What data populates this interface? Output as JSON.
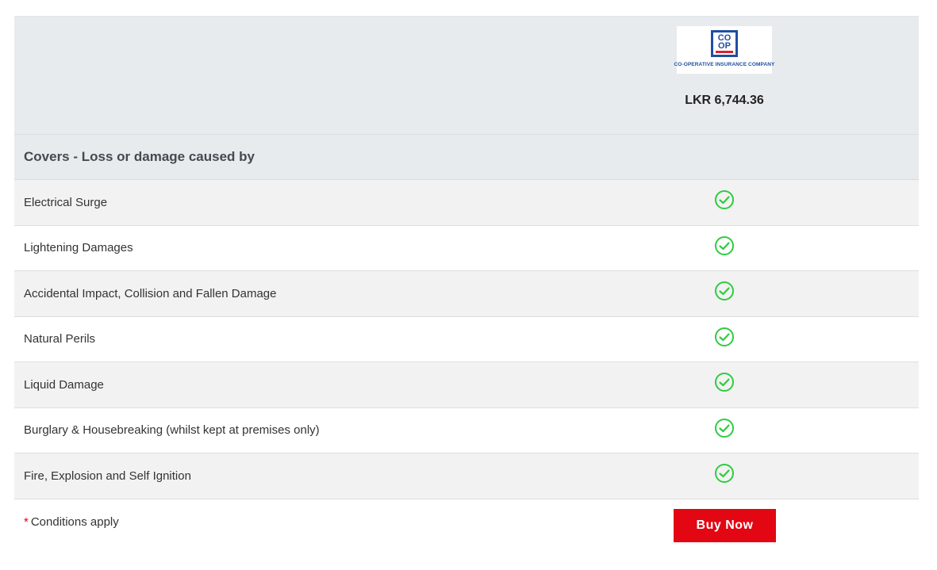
{
  "provider": {
    "logo_letters": [
      "CO",
      "OP"
    ],
    "logo_caption": "CO-OPERATIVE INSURANCE COMPANY",
    "price": "LKR 6,744.36"
  },
  "section": {
    "title": "Covers - Loss or damage caused by"
  },
  "covers": [
    {
      "label": "Electrical Surge",
      "covered": true
    },
    {
      "label": "Lightening Damages",
      "covered": true
    },
    {
      "label": "Accidental Impact, Collision and Fallen Damage",
      "covered": true
    },
    {
      "label": "Natural Perils",
      "covered": true
    },
    {
      "label": "Liquid Damage",
      "covered": true
    },
    {
      "label": "Burglary & Housebreaking (whilst kept at premises only)",
      "covered": true
    },
    {
      "label": "Fire, Explosion and Self Ignition",
      "covered": true
    }
  ],
  "footer": {
    "asterisk": "*",
    "conditions": "Conditions apply",
    "buy_label": "Buy Now"
  },
  "colors": {
    "check": "#2ecc40",
    "button": "#e30613",
    "header_bg": "#e8ebee"
  },
  "icons": {
    "check": "check-circle-icon",
    "logo": "coop-logo"
  }
}
